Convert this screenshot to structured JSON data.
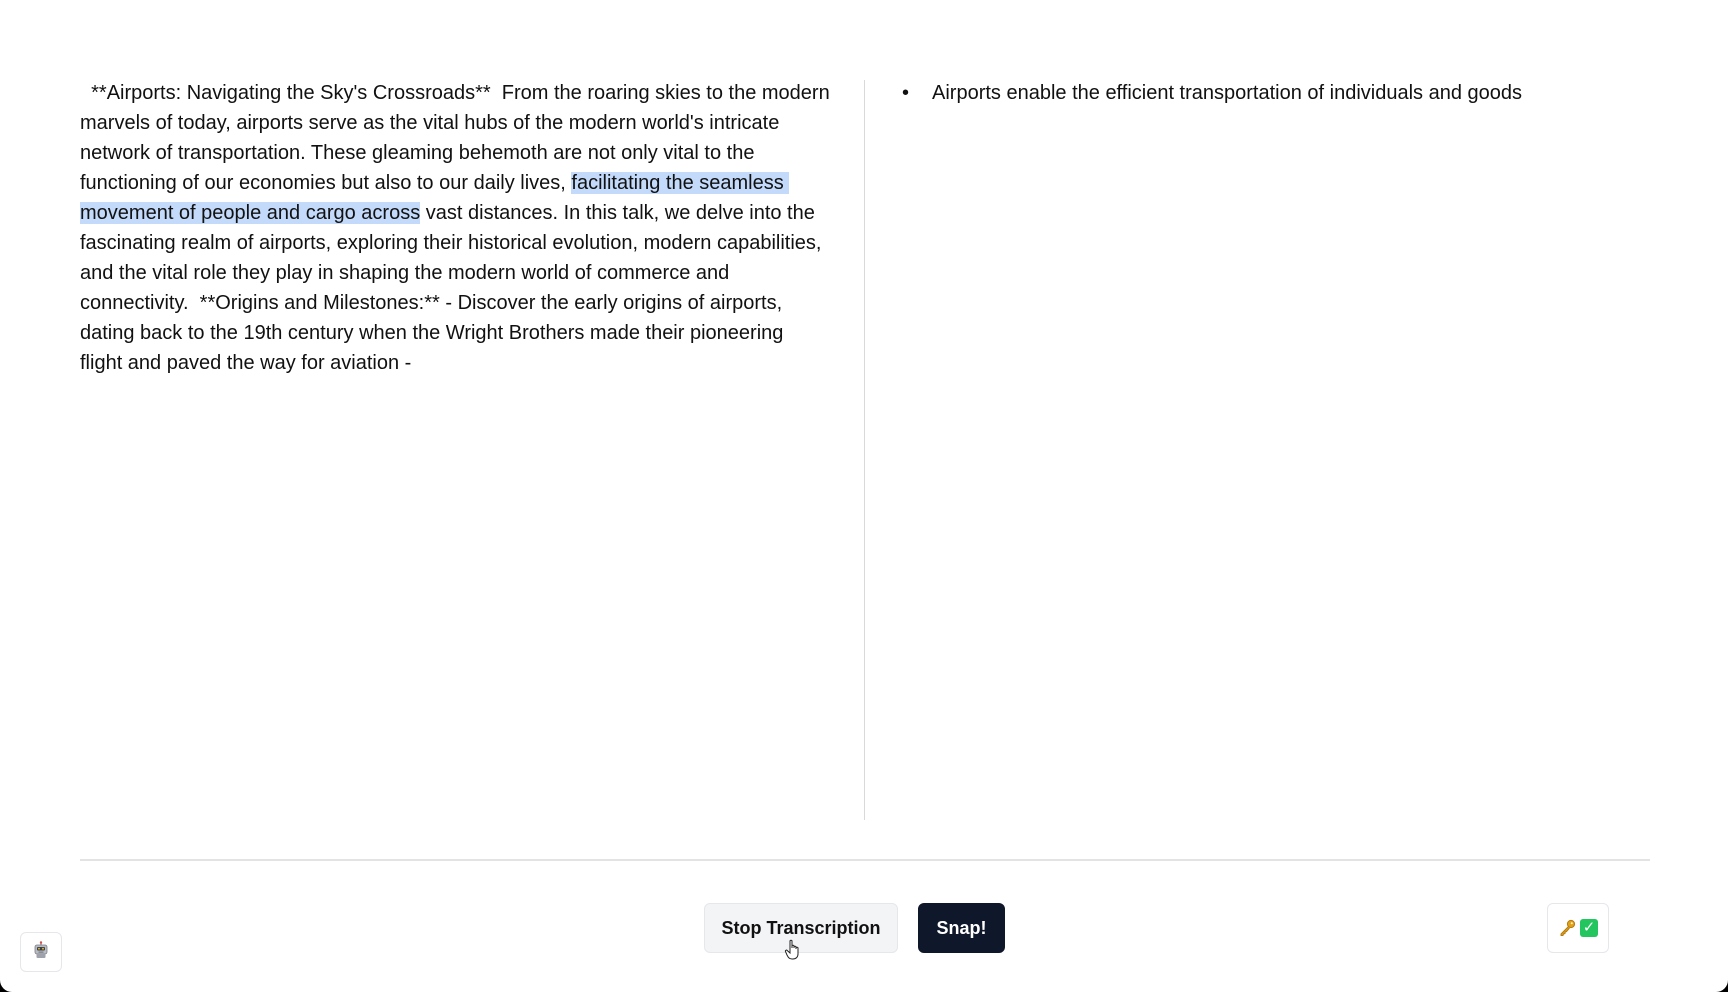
{
  "transcript": {
    "text_before": "  **Airports: Navigating the Sky's Crossroads**  From the roaring skies to the modern marvels of today, airports serve as the vital hubs of the modern world's intricate network of transportation. These gleaming behemoth are not only vital to the functioning of our economies but also to our daily lives, ",
    "text_highlighted": "facilitating the seamless movement of people and cargo across",
    "text_after": " vast distances. In this talk, we delve into the fascinating realm of airports, exploring their historical evolution, modern capabilities, and the vital role they play in shaping the modern world of commerce and connectivity.  **Origins and Milestones:** - Discover the early origins of airports, dating back to the 19th century when the Wright Brothers made their pioneering flight and paved the way for aviation -"
  },
  "notes": {
    "items": [
      {
        "label": "Airports enable the efficient transportation of individuals and goods"
      }
    ]
  },
  "controls": {
    "stop_label": "Stop Transcription",
    "snap_label": "Snap!",
    "status_icons": [
      "key-icon",
      "check-icon"
    ],
    "corner_icon": "robot-icon"
  },
  "colors": {
    "highlight": "#c3dafa",
    "snap_button": "#0f172a",
    "check": "#22c55e"
  }
}
